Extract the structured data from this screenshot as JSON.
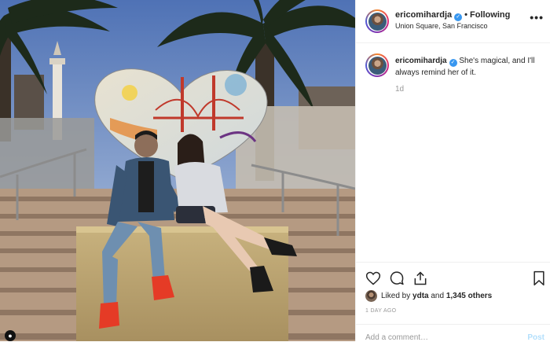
{
  "post": {
    "username": "ericomihardja",
    "follow_separator": "•",
    "follow_status": "Following",
    "location": "Union Square, San Francisco",
    "more_label": "•••",
    "caption": "She's magical, and I'll always remind her of it.",
    "caption_age": "1d",
    "liked_by_prefix": "Liked by",
    "liked_by_user": "ydta",
    "liked_by_joiner": "and",
    "liked_by_others": "1,345 others",
    "date": "1 DAY AGO",
    "add_comment_placeholder": "Add a comment…",
    "post_button": "Post"
  },
  "icons": {
    "verified": "verified-badge-icon",
    "like": "heart-icon",
    "comment": "comment-bubble-icon",
    "share": "share-icon",
    "save": "bookmark-icon",
    "more": "more-options-icon"
  },
  "colors": {
    "verified": "#3897f0",
    "post_disabled": "#b2dffc",
    "muted": "#999999",
    "text": "#262626"
  }
}
